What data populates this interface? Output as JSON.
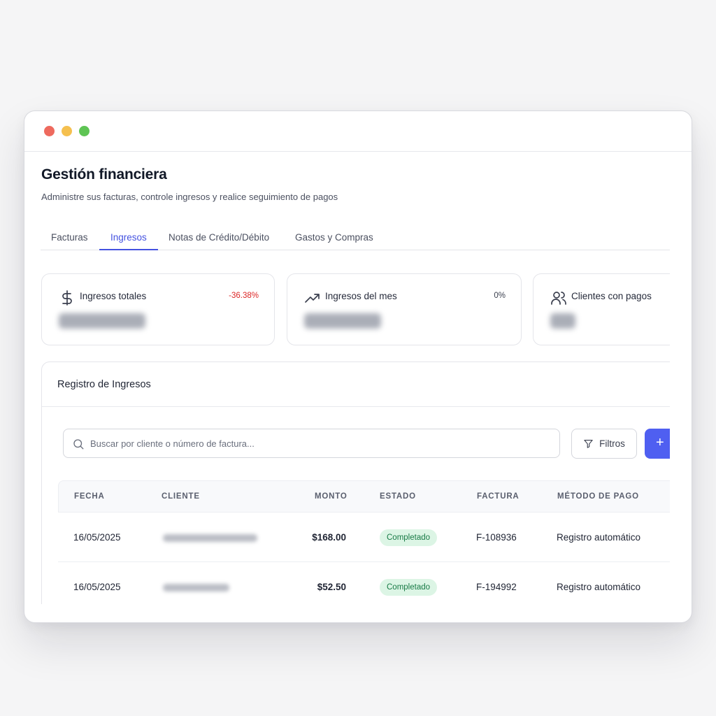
{
  "window": {
    "controls": {
      "close_color": "#ee6a5e",
      "minimize_color": "#f5c04f",
      "maximize_color": "#5ec454"
    }
  },
  "header": {
    "title": "Gestión financiera",
    "subtitle": "Administre sus facturas, controle ingresos y realice seguimiento de pagos"
  },
  "tabs": [
    {
      "label": "Facturas",
      "active": false
    },
    {
      "label": "Ingresos",
      "active": true
    },
    {
      "label": "Notas de Crédito/Débito",
      "active": false
    },
    {
      "label": "Gastos y Compras",
      "active": false
    }
  ],
  "stats": [
    {
      "label": "Ingresos totales",
      "change": "-36.38%",
      "change_color": "#dc2626",
      "icon": "dollar-icon"
    },
    {
      "label": "Ingresos del mes",
      "change": "0%",
      "change_color": "#3a3f4e",
      "icon": "trending-up-icon"
    },
    {
      "label": "Clientes con pagos",
      "change": "",
      "icon": "users-icon"
    }
  ],
  "register": {
    "title": "Registro de Ingresos",
    "search_placeholder": "Buscar por cliente o número de factura...",
    "filters_label": "Filtros",
    "add_label": "+",
    "columns": [
      "FECHA",
      "CLIENTE",
      "MONTO",
      "ESTADO",
      "FACTURA",
      "MÉTODO DE PAGO"
    ],
    "rows": [
      {
        "date": "16/05/2025",
        "amount": "$168.00",
        "status": "Completado",
        "invoice": "F-108936",
        "method": "Registro automático"
      },
      {
        "date": "16/05/2025",
        "amount": "$52.50",
        "status": "Completado",
        "invoice": "F-194992",
        "method": "Registro automático"
      }
    ]
  },
  "colors": {
    "accent": "#4f5ff1",
    "tab_active": "#4452e0",
    "success_bg": "#dcf5e5",
    "success_text": "#177a45"
  }
}
